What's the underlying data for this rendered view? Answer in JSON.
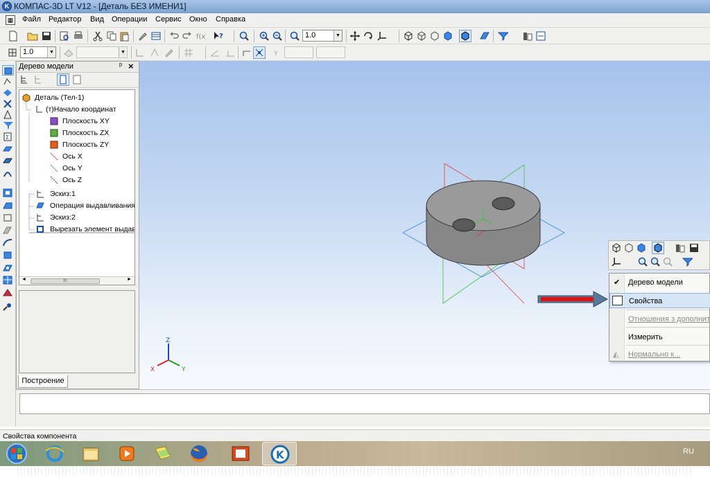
{
  "window": {
    "title": "КОМПАС-3D LT V12 - [Деталь БЕЗ ИМЕНИ1]"
  },
  "menu": [
    "Файл",
    "Редактор",
    "Вид",
    "Операции",
    "Сервис",
    "Окно",
    "Справка"
  ],
  "toolbar": {
    "zoom_value": "1.0",
    "step_value": "1.0"
  },
  "tree_panel": {
    "title": "Дерево модели",
    "pin_glyph": "ᵖ",
    "close_glyph": "×",
    "items": [
      "Деталь (Тел-1)",
      "(т)Начало координат",
      "Плоскость XY",
      "Плоскость ZX",
      "Плоскость ZY",
      "Ось X",
      "Ось Y",
      "Ось Z",
      "Эскиз:1",
      "Операция выдавливания",
      "Эскиз:2",
      "Вырезать элемент выдав"
    ],
    "tab": "Построение",
    "scroll_thumb": "III"
  },
  "axes": {
    "x": "X",
    "y": "Y",
    "z": "Z"
  },
  "context_menu": {
    "items": [
      "Дерево модели",
      "Свойства",
      "Отношения з дополнит",
      "Измерить",
      "Нормально к..."
    ],
    "checked": "Дерево модели",
    "highlighted": "Свойства",
    "disabled": [
      "Отношения з дополнит",
      "Нормально к..."
    ]
  },
  "status": {
    "text": "Свойства компонента"
  },
  "taskbar": {
    "apps": [
      "start-orb",
      "internet-explorer",
      "file-explorer",
      "media-player",
      "sticky-notes",
      "firefox",
      "powerpoint",
      "kompas"
    ],
    "active": "kompas",
    "language": "RU"
  },
  "colors": {
    "highlight_arrow": "#e01010",
    "context_highlight": "#d6e6f7",
    "part_body": "#8c8c8c"
  }
}
